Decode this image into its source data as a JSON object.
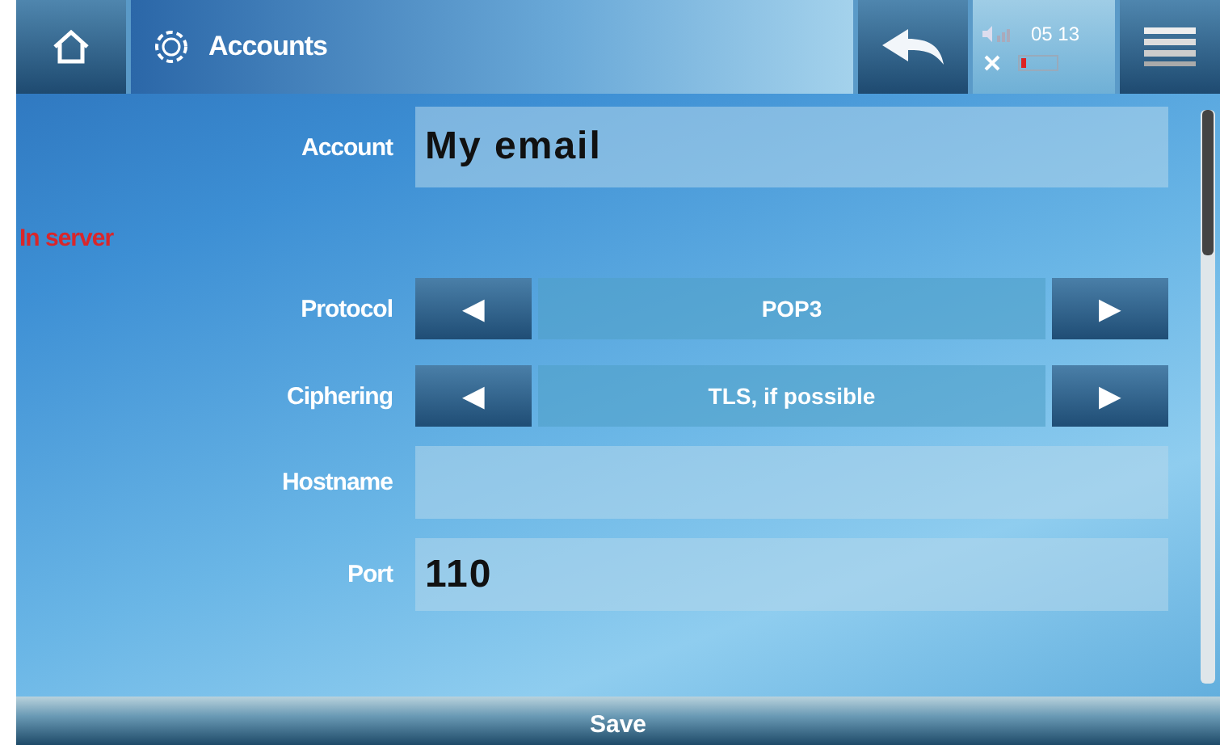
{
  "top_bar": {
    "title": "Accounts",
    "clock": "05 13"
  },
  "form": [
    {
      "kind": "field",
      "label": "Account",
      "value": "My email"
    },
    {
      "kind": "section",
      "label": "In server"
    },
    {
      "kind": "selector",
      "label": "Protocol",
      "value": "POP3",
      "prev": "◀",
      "next": "▶"
    },
    {
      "kind": "selector",
      "label": "Ciphering",
      "value": "TLS, if possible",
      "prev": "◀",
      "next": "▶"
    },
    {
      "kind": "field",
      "label": "Hostname"
    },
    {
      "kind": "field",
      "label": "Port",
      "value": "110"
    }
  ],
  "save_button": "Save"
}
